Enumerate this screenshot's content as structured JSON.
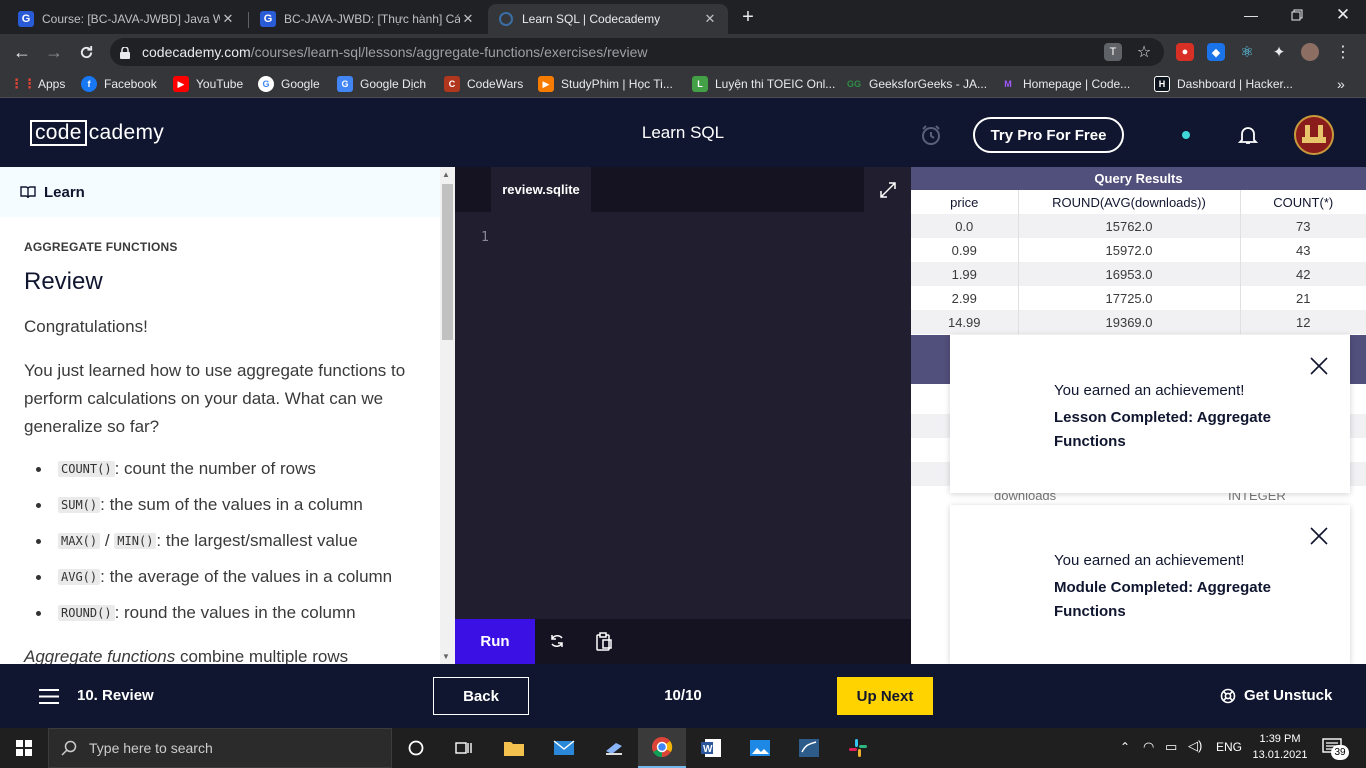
{
  "browser": {
    "tabs": [
      {
        "title": "Course: [BC-JAVA-JWBD] Java We",
        "icon": "g-icon",
        "active": false
      },
      {
        "title": "BC-JAVA-JWBD: [Thực hành] Các",
        "icon": "g-icon",
        "active": false
      },
      {
        "title": "Learn SQL | Codecademy",
        "icon": "codecademy-icon",
        "active": true
      }
    ],
    "url_host": "codecademy.com",
    "url_path": "/courses/learn-sql/lessons/aggregate-functions/exercises/review",
    "bookmarks": [
      {
        "label": "Apps",
        "icon": "apps-grid-icon"
      },
      {
        "label": "Facebook",
        "icon": "facebook-icon"
      },
      {
        "label": "YouTube",
        "icon": "youtube-icon"
      },
      {
        "label": "Google",
        "icon": "google-icon"
      },
      {
        "label": "Google Dịch",
        "icon": "google-translate-icon"
      },
      {
        "label": "CodeWars",
        "icon": "codewars-icon"
      },
      {
        "label": "StudyPhim | Học Ti...",
        "icon": "studyphim-icon"
      },
      {
        "label": "Luyện thi TOEIC Onl...",
        "icon": "toeic-icon"
      },
      {
        "label": "GeeksforGeeks - JA...",
        "icon": "geeksforgeeks-icon"
      },
      {
        "label": "Homepage | Code...",
        "icon": "codecademy-bm-icon"
      },
      {
        "label": "Dashboard | Hacker...",
        "icon": "hackerrank-icon"
      }
    ],
    "overflow": "»"
  },
  "header": {
    "logo_left": "code",
    "logo_right": "cademy",
    "course_title": "Learn SQL",
    "pro_button": "Try Pro For Free"
  },
  "learn": {
    "header": "Learn",
    "section": "AGGREGATE FUNCTIONS",
    "title": "Review",
    "congrats": "Congratulations!",
    "intro": "You just learned how to use aggregate functions to perform calculations on your data. What can we generalize so far?",
    "bullets": [
      {
        "code": "COUNT()",
        "text": ": count the number of rows"
      },
      {
        "code": "SUM()",
        "text": ": the sum of the values in a column"
      },
      {
        "code": "MAX()",
        "code2": "MIN()",
        "sep": " / ",
        "text": ": the largest/smallest value"
      },
      {
        "code": "AVG()",
        "text": ": the average of the values in a column"
      },
      {
        "code": "ROUND()",
        "text": ": round the values in the column"
      }
    ],
    "footer_italic": "Aggregate functions",
    "footer_rest": " combine multiple rows"
  },
  "editor": {
    "tab": "review.sqlite",
    "line": "1",
    "run": "Run"
  },
  "results": {
    "title": "Query Results",
    "columns": [
      "price",
      "ROUND(AVG(downloads))",
      "COUNT(*)"
    ],
    "rows": [
      [
        "0.0",
        "15762.0",
        "73"
      ],
      [
        "0.99",
        "15972.0",
        "43"
      ],
      [
        "1.99",
        "16953.0",
        "42"
      ],
      [
        "2.99",
        "17725.0",
        "21"
      ],
      [
        "14.99",
        "19369.0",
        "12"
      ]
    ],
    "hidden_col_a": "downloads",
    "hidden_col_b": "INTEGER"
  },
  "toasts": [
    {
      "line1": "You earned an achievement!",
      "line2": "Lesson Completed: Aggregate Functions"
    },
    {
      "line1": "You earned an achievement!",
      "line2": "Module Completed: Aggregate Functions"
    }
  ],
  "footer": {
    "lesson": "10. Review",
    "back": "Back",
    "progress": "10/10",
    "next": "Up Next",
    "unstuck": "Get Unstuck"
  },
  "taskbar": {
    "search_placeholder": "Type here to search",
    "lang": "ENG",
    "time": "1:39 PM",
    "date": "13.01.2021",
    "notif_count": "39"
  },
  "colors": {
    "navy": "#10162f",
    "run_purple": "#3a10e5",
    "results_purple": "#514f7b",
    "yellow": "#ffd300",
    "editor_bg": "#211e2f"
  }
}
